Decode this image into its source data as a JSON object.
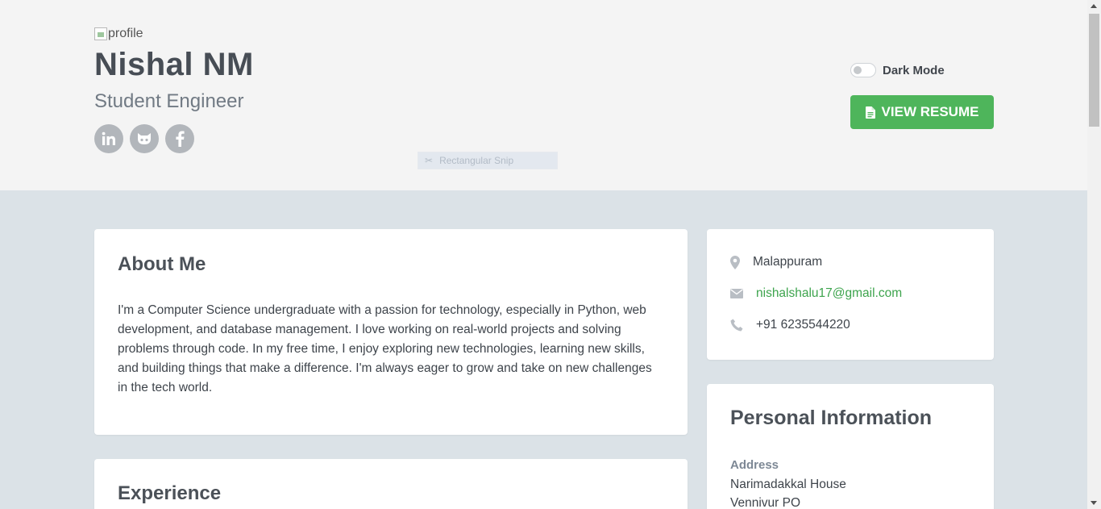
{
  "header": {
    "profile_alt": "profile",
    "name": "Nishal NM",
    "role": "Student Engineer",
    "socials": [
      {
        "icon": "linkedin-icon"
      },
      {
        "icon": "github-icon"
      },
      {
        "icon": "facebook-icon"
      }
    ],
    "dark_mode_label": "Dark Mode",
    "dark_mode_on": false,
    "resume_label": "VIEW RESUME",
    "snip_label": "Rectangular Snip"
  },
  "about": {
    "title": "About Me",
    "text": "I'm a Computer Science undergraduate with a passion for technology, especially in Python, web development, and database management. I love working on real-world projects and solving problems through code. In my free time, I enjoy exploring new technologies, learning new skills, and building things that make a difference. I'm always eager to grow and take on new challenges in the tech world."
  },
  "experience": {
    "title": "Experience"
  },
  "contact": {
    "location": "Malappuram",
    "email": "nishalshalu17@gmail.com",
    "phone": "+91 6235544220"
  },
  "personal": {
    "title": "Personal Information",
    "address_label": "Address",
    "address_lines": [
      "Narimadakkal House",
      "Vennivur PO"
    ]
  },
  "colors": {
    "accent": "#4eb55b",
    "page_bg": "#dbe2e7",
    "header_bg": "#f4f4f4"
  }
}
